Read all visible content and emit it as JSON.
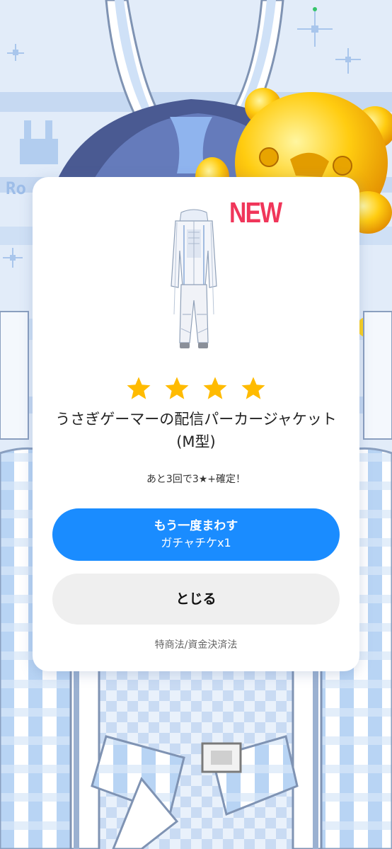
{
  "modal": {
    "new_badge": "NEW",
    "rarity_stars": 4,
    "item_name": "うさぎゲーマーの配信パーカージャケット (M型)",
    "pity_note": "あと3回で3★+確定！",
    "spin_button": {
      "label": "もう一度まわす",
      "cost": "ガチャチケx1"
    },
    "close_button_label": "とじる",
    "legal_link": "特商法/資金決済法"
  },
  "icons": {
    "star": "star-icon",
    "new_badge_color": "#f0365a",
    "star_color": "#ffbb00",
    "primary_button_color": "#1a8cff"
  },
  "background": {
    "logo_fragment": "Ro"
  }
}
